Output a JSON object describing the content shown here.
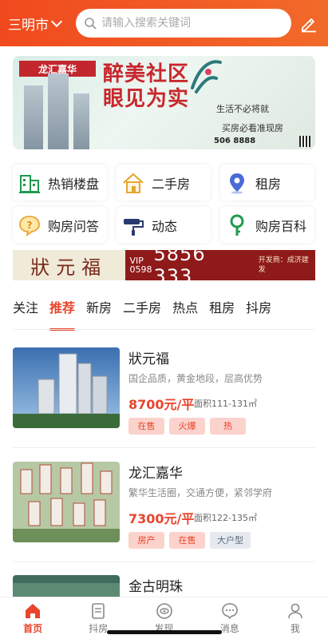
{
  "header": {
    "city": "三明市",
    "search_placeholder": "请输入搜索关键词",
    "colors": {
      "accent": "#f04a1e"
    }
  },
  "banner": {
    "brand": "龙汇嘉华",
    "headline1": "醉美社区",
    "headline2": "眼见为实",
    "slogan1": "生活不必将就",
    "slogan2": "买房必看准现房",
    "phone": "506 8888"
  },
  "quick_menu": [
    {
      "label": "热销楼盘",
      "icon": "building-icon"
    },
    {
      "label": "二手房",
      "icon": "house-icon"
    },
    {
      "label": "租房",
      "icon": "location-pin-icon"
    },
    {
      "label": "购房问答",
      "icon": "question-bubble-icon"
    },
    {
      "label": "动态",
      "icon": "paint-roller-icon"
    },
    {
      "label": "购房百科",
      "icon": "key-icon"
    }
  ],
  "ad": {
    "name": "狀元福",
    "vip_top": "VIP",
    "vip_bottom": "0598",
    "tel": "5856 333",
    "developer": "开发商：成济建发"
  },
  "tabs": [
    "关注",
    "推荐",
    "新房",
    "二手房",
    "热点",
    "租房",
    "抖房"
  ],
  "active_tab": "推荐",
  "listings": [
    {
      "title": "狀元福",
      "features": "国企品质，黄金地段，层高优势",
      "price": "8700元/平",
      "area": "面积111-131㎡",
      "tags": [
        {
          "text": "在售",
          "style": "red"
        },
        {
          "text": "火爆",
          "style": "red"
        },
        {
          "text": "热",
          "style": "red"
        }
      ]
    },
    {
      "title": "龙汇嘉华",
      "features": "繁华生活圈，交通方便，紧邻学府",
      "price": "7300元/平",
      "area": "面积122-135㎡",
      "tags": [
        {
          "text": "房产",
          "style": "red"
        },
        {
          "text": "在售",
          "style": "red"
        },
        {
          "text": "大户型",
          "style": "grey"
        }
      ]
    },
    {
      "title": "金古明珠"
    }
  ],
  "bottom_nav": [
    {
      "label": "首页",
      "icon": "home-icon",
      "active": true
    },
    {
      "label": "抖房",
      "icon": "document-icon",
      "active": false
    },
    {
      "label": "发现",
      "icon": "eye-icon",
      "active": false
    },
    {
      "label": "消息",
      "icon": "chat-icon",
      "active": false
    },
    {
      "label": "我",
      "icon": "user-icon",
      "active": false
    }
  ]
}
